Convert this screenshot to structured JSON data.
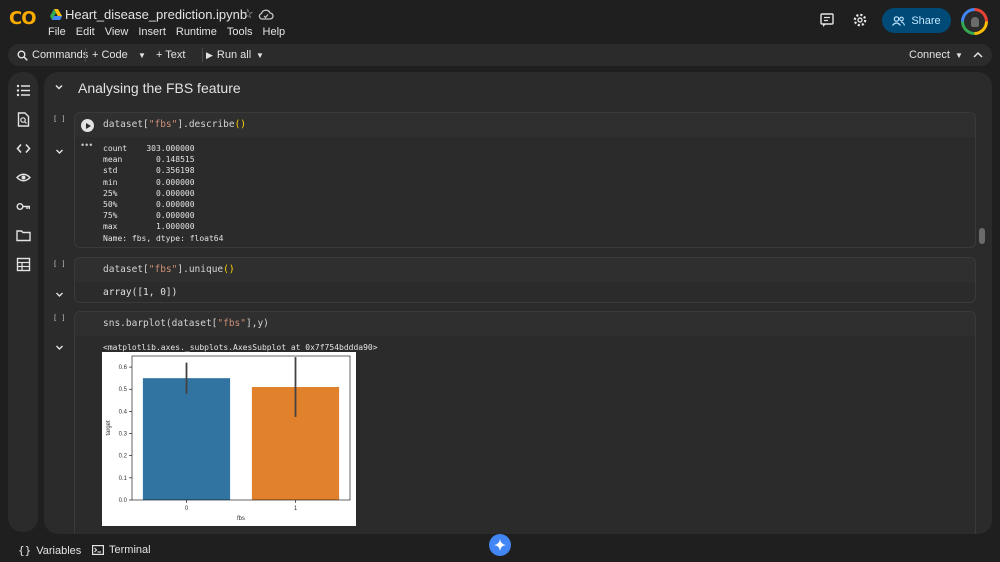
{
  "app": {
    "logo_text": "CO",
    "title": "Heart_disease_prediction.ipynb",
    "menus": [
      "File",
      "Edit",
      "View",
      "Insert",
      "Runtime",
      "Tools",
      "Help"
    ],
    "share_label": "Share",
    "brand_color": "#f9ab00",
    "accent_color": "#004a77"
  },
  "toolbar": {
    "commands": "Commands",
    "code": "+ Code",
    "text": "+ Text",
    "run_all": "Run all",
    "connect": "Connect"
  },
  "sidebar": {
    "icons": [
      "table-of-contents-icon",
      "find-icon",
      "code-snippets-icon",
      "variables-inspector-icon",
      "secrets-key-icon",
      "files-folder-icon",
      "data-table-icon"
    ]
  },
  "section": {
    "title": "Analysing the FBS feature"
  },
  "cells": [
    {
      "bracket": "[ ]",
      "code_prefix": "dataset[",
      "code_string": "\"fbs\"",
      "code_suffix": "].describe",
      "code_parens": "()",
      "output_lines": [
        "count    303.000000",
        "mean       0.148515",
        "std        0.356198",
        "min        0.000000",
        "25%        0.000000",
        "50%        0.000000",
        "75%        0.000000",
        "max        1.000000",
        "Name: fbs, dtype: float64"
      ]
    },
    {
      "bracket": "[ ]",
      "code_prefix": "dataset[",
      "code_string": "\"fbs\"",
      "code_suffix": "].unique",
      "code_parens": "()",
      "output_lines": [
        "array([1, 0])"
      ]
    },
    {
      "bracket": "[ ]",
      "code_prefix": "sns.barplot(dataset[",
      "code_string": "\"fbs\"",
      "code_suffix": "],y)",
      "code_parens": "",
      "output_lines": [
        "<matplotlib.axes._subplots.AxesSubplot at 0x7f754bddda90>"
      ]
    }
  ],
  "chart_data": {
    "type": "bar",
    "categories": [
      "0",
      "1"
    ],
    "values": [
      0.55,
      0.51
    ],
    "errors_low": [
      0.48,
      0.375
    ],
    "errors_high": [
      0.62,
      0.645
    ],
    "colors": [
      "#3274a1",
      "#e1812c"
    ],
    "xlabel": "fbs",
    "ylabel": "target",
    "ylim": [
      0,
      0.65
    ],
    "yticks": [
      "0.0",
      "0.1",
      "0.2",
      "0.3",
      "0.4",
      "0.5",
      "0.6"
    ],
    "grid": false
  },
  "bottom": {
    "variables": "Variables",
    "terminal": "Terminal"
  }
}
